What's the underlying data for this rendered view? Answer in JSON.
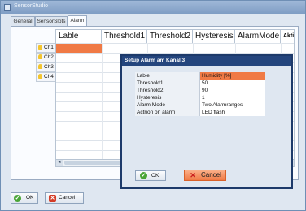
{
  "window": {
    "title": "SensorStudio"
  },
  "tabs": [
    {
      "label": "General"
    },
    {
      "label": "SensorSlots"
    },
    {
      "label": "Alarm"
    }
  ],
  "channels": [
    {
      "label": "Ch1"
    },
    {
      "label": "Ch2"
    },
    {
      "label": "Ch3"
    },
    {
      "label": "Ch4"
    }
  ],
  "grid": {
    "columns": [
      "Lable",
      "Threshold1",
      "Threshold2",
      "Hysteresis",
      "AlarmMode",
      "Aktio"
    ]
  },
  "dialog": {
    "title": "Setup Alarm am Kanal 3",
    "rows": [
      {
        "key": "Lable",
        "value": "Humidity [%]"
      },
      {
        "key": "Threshold1",
        "value": "50"
      },
      {
        "key": "Threshold2",
        "value": "90"
      },
      {
        "key": "Hysteresis",
        "value": "1"
      },
      {
        "key": "Alarm Mode",
        "value": "Two Alarmranges"
      },
      {
        "key": "Actrion on alarm",
        "value": "LED flash"
      }
    ],
    "ok_label": "OK",
    "cancel_label": "Cancel"
  },
  "footer": {
    "ok_label": "OK",
    "cancel_label": "Cancel"
  },
  "colors": {
    "selection": "#f07a45",
    "dialog_title": "#24457d",
    "window_bg": "#dfe7f1"
  }
}
